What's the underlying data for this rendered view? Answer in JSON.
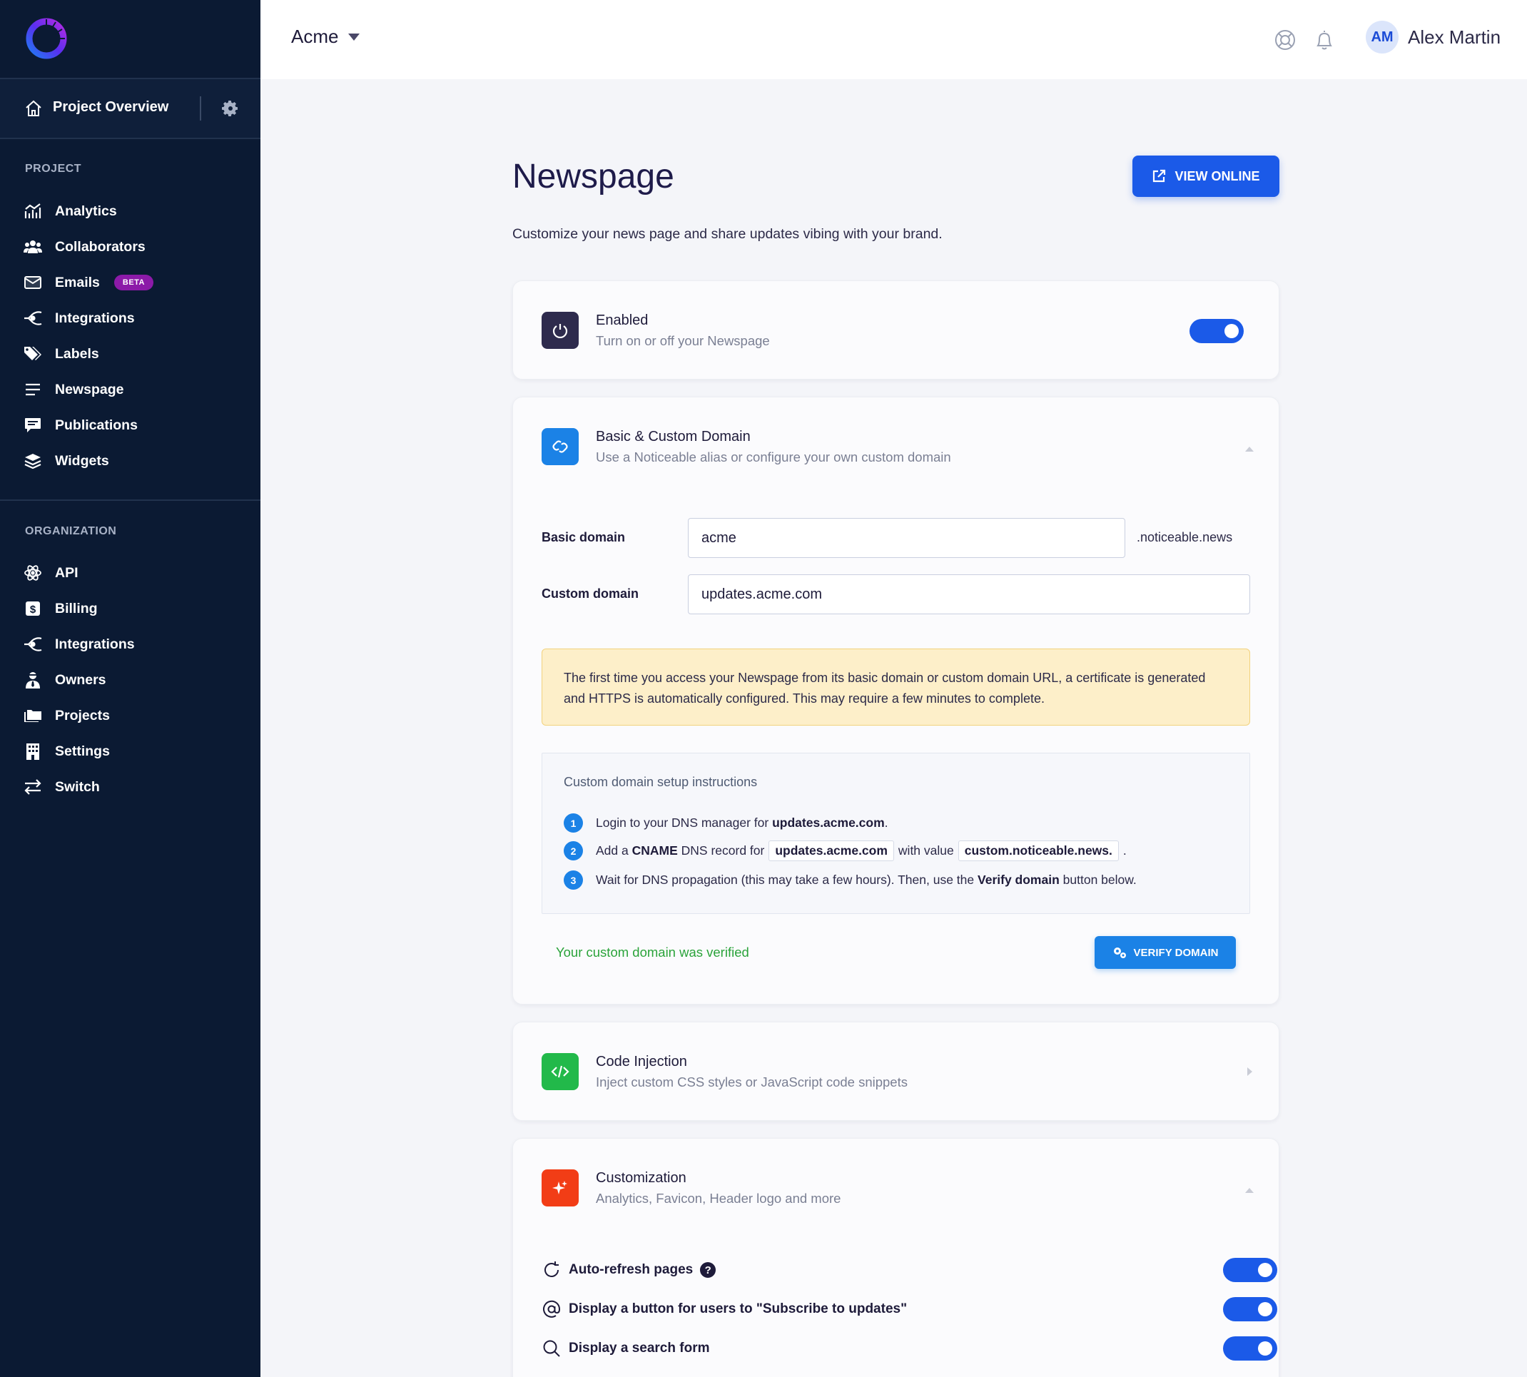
{
  "header": {
    "org_name": "Acme",
    "user_initials": "AM",
    "user_name": "Alex Martin"
  },
  "sidebar": {
    "project_overview": "Project Overview",
    "project_section": "PROJECT",
    "project_items": [
      {
        "label": "Analytics",
        "icon": "analytics-icon"
      },
      {
        "label": "Collaborators",
        "icon": "collaborators-icon"
      },
      {
        "label": "Emails",
        "icon": "email-icon",
        "badge": "BETA"
      },
      {
        "label": "Integrations",
        "icon": "integrations-icon"
      },
      {
        "label": "Labels",
        "icon": "tags-icon"
      },
      {
        "label": "Newspage",
        "icon": "menu-lines-icon"
      },
      {
        "label": "Publications",
        "icon": "comment-icon"
      },
      {
        "label": "Widgets",
        "icon": "layers-icon"
      }
    ],
    "org_section": "ORGANIZATION",
    "org_items": [
      {
        "label": "API",
        "icon": "atom-icon"
      },
      {
        "label": "Billing",
        "icon": "dollar-icon"
      },
      {
        "label": "Integrations",
        "icon": "integrations-icon"
      },
      {
        "label": "Owners",
        "icon": "user-tie-icon"
      },
      {
        "label": "Projects",
        "icon": "folders-icon"
      },
      {
        "label": "Settings",
        "icon": "building-icon"
      },
      {
        "label": "Switch",
        "icon": "switch-arrows-icon"
      }
    ]
  },
  "main": {
    "title": "Newspage",
    "view_online": "VIEW ONLINE",
    "subtitle": "Customize your news page and share updates vibing with your brand.",
    "enabled_card": {
      "title": "Enabled",
      "subtitle": "Turn on or off your Newspage",
      "enabled": true
    },
    "domain_card": {
      "title": "Basic & Custom Domain",
      "subtitle": "Use a Noticeable alias or configure your own custom domain",
      "basic_label": "Basic domain",
      "basic_value": "acme",
      "basic_suffix": ".noticeable.news",
      "custom_label": "Custom domain",
      "custom_value": "updates.acme.com",
      "warning": "The first time you access your Newspage from its basic domain or custom domain URL, a certificate is generated and HTTPS is automatically configured. This may require a few minutes to complete.",
      "instructions_title": "Custom domain setup instructions",
      "step1_num": "1",
      "step1_text": "Login to your DNS manager for",
      "step1_domain": "updates.acme.com",
      "step1_end": ".",
      "step2_num": "2",
      "step2_a": "Add a",
      "step2_cname": "CNAME",
      "step2_b": "DNS record for",
      "step2_domain": "updates.acme.com",
      "step2_c": "with value",
      "step2_value": "custom.noticeable.news.",
      "step2_end": ".",
      "step3_num": "3",
      "step3_a": "Wait for DNS propagation (this may take a few hours). Then, use the",
      "step3_bold": "Verify domain",
      "step3_b": "button below.",
      "verified_text": "Your custom domain was verified",
      "verify_button": "VERIFY DOMAIN"
    },
    "code_card": {
      "title": "Code Injection",
      "subtitle": "Inject custom CSS styles or JavaScript code snippets"
    },
    "custom_card": {
      "title": "Customization",
      "subtitle": "Analytics, Favicon, Header logo and more",
      "options": [
        {
          "label": "Auto-refresh pages",
          "icon": "refresh-icon",
          "enabled": true,
          "help": "?"
        },
        {
          "label": "Display a button for users to \"Subscribe to updates\"",
          "icon": "at-icon",
          "enabled": true
        },
        {
          "label": "Display a search form",
          "icon": "search-icon",
          "enabled": true
        }
      ]
    }
  },
  "colors": {
    "sidebar_bg": "#0b1a33",
    "primary": "#1b5ae8",
    "info": "#1b82e6",
    "success": "#2aa33a",
    "beta_badge": "#8c1aa8",
    "code_icon_bg": "#22b94a",
    "custom_icon_bg": "#f23d16"
  }
}
